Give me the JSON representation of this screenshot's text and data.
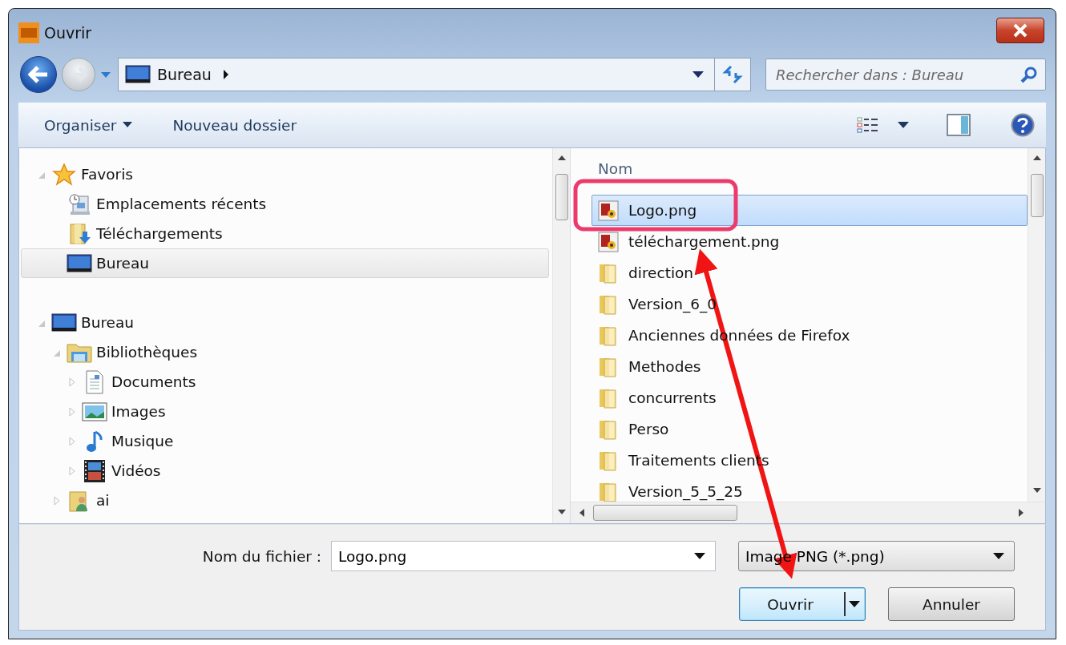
{
  "window": {
    "title": "Ouvrir"
  },
  "address": {
    "location": "Bureau",
    "search_placeholder": "Rechercher dans : Bureau"
  },
  "toolbar": {
    "buttons": [
      {
        "label": "Organiser",
        "menu": true
      },
      {
        "label": "Nouveau dossier",
        "menu": false
      }
    ]
  },
  "tree": [
    {
      "label": "Favoris",
      "expanded": true,
      "selected": false,
      "children": [
        {
          "label": "Emplacements récents",
          "selected": false
        },
        {
          "label": "Téléchargements",
          "selected": false
        },
        {
          "label": "Bureau",
          "selected": true
        }
      ]
    },
    {
      "label": "Bureau",
      "expanded": true,
      "selected": false,
      "children": [
        {
          "label": "Bibliothèques",
          "expanded": true,
          "selected": false,
          "children": [
            {
              "label": "Documents",
              "expanded": false,
              "selected": false
            },
            {
              "label": "Images",
              "expanded": false,
              "selected": false
            },
            {
              "label": "Musique",
              "expanded": false,
              "selected": false
            },
            {
              "label": "Vidéos",
              "expanded": false,
              "selected": false
            }
          ]
        },
        {
          "label": "ai",
          "expanded": false,
          "selected": false
        }
      ]
    }
  ],
  "file_list": {
    "column": "Nom",
    "files": [
      {
        "name": "Logo.png",
        "kind": "image",
        "selected": true
      },
      {
        "name": "téléchargement.png",
        "kind": "image",
        "selected": false
      },
      {
        "name": "direction",
        "kind": "folder",
        "selected": false
      },
      {
        "name": "Version_6_0",
        "kind": "folder",
        "selected": false
      },
      {
        "name": "Anciennes données de Firefox",
        "kind": "folder",
        "selected": false
      },
      {
        "name": "Methodes",
        "kind": "folder",
        "selected": false
      },
      {
        "name": "concurrents",
        "kind": "folder",
        "selected": false
      },
      {
        "name": "Perso",
        "kind": "folder",
        "selected": false
      },
      {
        "name": "Traitements clients",
        "kind": "folder",
        "selected": false
      },
      {
        "name": "Version_5_5_25",
        "kind": "folder",
        "selected": false
      }
    ]
  },
  "footer": {
    "filename_label": "Nom du fichier :",
    "filename": "Logo.png",
    "file_type": "Image PNG (*.png)",
    "buttons": [
      {
        "label": "Ouvrir",
        "kind": "split",
        "default": true
      },
      {
        "label": "Annuler",
        "kind": "plain",
        "default": false
      }
    ]
  }
}
